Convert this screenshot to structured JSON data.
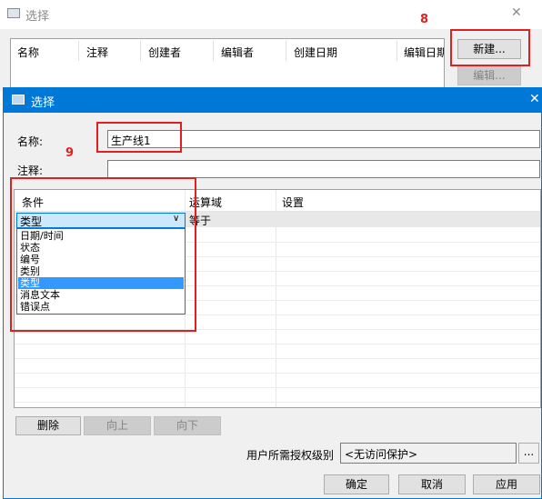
{
  "bg_dialog": {
    "title": "选择",
    "close_glyph": "✕",
    "columns": [
      "名称",
      "注释",
      "创建者",
      "编辑者",
      "创建日期",
      "编辑日期"
    ],
    "new_button": "新建...",
    "edit_button": "编辑..."
  },
  "annotations": {
    "step8": "8",
    "step9": "9"
  },
  "dialog": {
    "title": "选择",
    "close_glyph": "✕",
    "name_label": "名称:",
    "name_value": "生产线1",
    "comment_label": "注释:",
    "comment_value": "",
    "conditions": {
      "headers": [
        "条件",
        "运算域",
        "设置"
      ],
      "row": {
        "condition": "类型",
        "operator": "等于",
        "setting": ""
      },
      "dropdown_glyph": "∨",
      "dropdown_options": [
        "日期/时间",
        "状态",
        "编号",
        "类别",
        "类型",
        "消息文本",
        "错误点"
      ],
      "selected_option": "类型"
    },
    "buttons": {
      "delete": "删除",
      "up": "向上",
      "down": "向下"
    },
    "auth_label": "用户所需授权级别",
    "auth_value": "<无访问保护>",
    "auth_browse": "...",
    "ok": "确定",
    "cancel": "取消",
    "apply": "应用"
  },
  "colors": {
    "title_bar_active": "#0078d7",
    "annotation_red": "#e02020",
    "selection_blue": "#3399ff",
    "dropdown_field": "#cce8ff"
  }
}
